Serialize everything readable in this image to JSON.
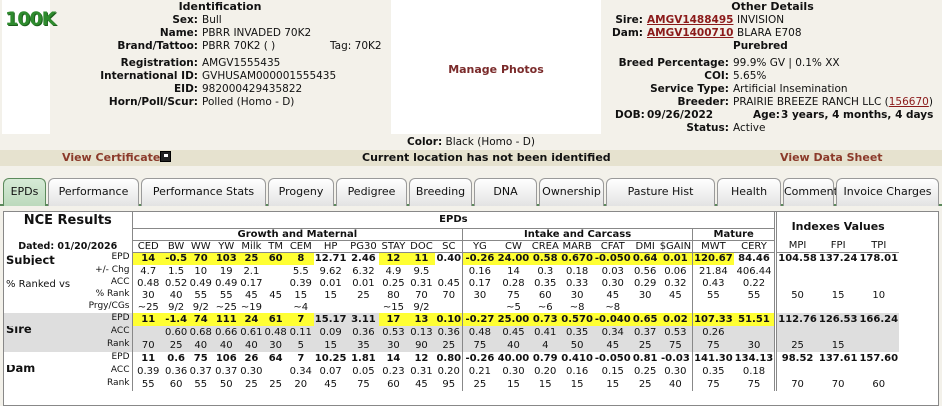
{
  "logo": {
    "text": "100K"
  },
  "identification": {
    "title": "Identification",
    "fields": [
      {
        "label": "Sex:",
        "value": "Bull"
      },
      {
        "label": "Name:",
        "value": "PBRR INVADED 70K2"
      },
      {
        "label": "Brand/Tattoo:",
        "value": "PBRR 70K2 ( )",
        "extra": "Tag: 70K2"
      },
      {
        "label": "Registration:",
        "value": "AMGV1555435"
      },
      {
        "label": "International ID:",
        "value": "GVHUSAM000001555435"
      },
      {
        "label": "EID:",
        "value": "982000429435822"
      },
      {
        "label": "Horn/Poll/Scur:",
        "value": "Polled (Homo - D)"
      }
    ],
    "color_label": "Color:",
    "color_value": "Black (Homo - D)"
  },
  "photos": {
    "manage_label": "Manage Photos"
  },
  "other_details": {
    "title": "Other Details",
    "sire_label": "Sire:",
    "sire_link": "AMGV1488495",
    "sire_name": "INVISION",
    "dam_label": "Dam:",
    "dam_link": "AMGV1400710",
    "dam_name": "BLARA E708",
    "breed_status": "Purebred",
    "fields": [
      {
        "label": "Breed Percentage:",
        "value": "99.9% GV | 0.1% XX"
      },
      {
        "label": "COI:",
        "value": "5.65%"
      },
      {
        "label": "Service Type:",
        "value": "Artificial Insemination"
      }
    ],
    "breeder_label": "Breeder:",
    "breeder_name": "PRAIRIE BREEZE RANCH LLC (",
    "breeder_link": "156670",
    "breeder_close": ")",
    "dob_label": "DOB:",
    "dob_value": "09/26/2022",
    "age_label": "Age:",
    "age_value": "3 years, 4 months, 4 days",
    "status_label": "Status:",
    "status_value": "Active"
  },
  "actions": {
    "view_certificate": "View Certificate",
    "location": "Current location has not been identified",
    "view_data_sheet": "View Data Sheet"
  },
  "tabs": [
    "EPDs",
    "Performance",
    "Performance Stats",
    "Progeny",
    "Pedigree",
    "Breeding",
    "DNA",
    "Ownership",
    "Pasture Hist",
    "Health",
    "Comments",
    "Invoice Charges"
  ],
  "active_tab": "EPDs",
  "epd_table": {
    "title": "NCE Results",
    "dated": "Dated: 01/20/2026",
    "epds_header": "EPDs",
    "indexes_header": "Indexes Values",
    "groups": [
      "Growth and Maternal",
      "Intake and Carcass",
      "Mature"
    ],
    "columns": [
      "CED",
      "BW",
      "WW",
      "YW",
      "Milk",
      "TM",
      "CEM",
      "HP",
      "PG30",
      "STAY",
      "DOC",
      "SC",
      "YG",
      "CW",
      "CREA",
      "MARB",
      "CFAT",
      "DMI",
      "$GAIN",
      "MWT",
      "CERY",
      "MPI",
      "FPI",
      "TPI"
    ],
    "subject": {
      "name": "Subject",
      "ranked_label": "% Ranked vs Active Gelbvieh Sires",
      "row_labels": [
        "EPD",
        "+/- Chg",
        "ACC",
        "% Rank",
        "Prgy/CGs"
      ],
      "epd": [
        "14",
        "-0.5",
        "70",
        "103",
        "25",
        "60",
        "8",
        "12.71",
        "2.46",
        "12",
        "11",
        "0.40",
        "-0.26",
        "24.00",
        "0.58",
        "0.670",
        "-0.050",
        "0.64",
        "0.01",
        "120.67",
        "84.46",
        "104.58",
        "137.24",
        "178.01"
      ],
      "chg": [
        "4.7",
        "1.5",
        "10",
        "19",
        "2.1",
        "",
        "5.5",
        "9.62",
        "6.32",
        "4.9",
        "9.5",
        "",
        "0.16",
        "14",
        "0.3",
        "0.18",
        "0.03",
        "0.56",
        "0.06",
        "21.84",
        "406.44",
        "",
        "",
        ""
      ],
      "acc": [
        "0.48",
        "0.52",
        "0.49",
        "0.49",
        "0.17",
        "",
        "0.39",
        "0.01",
        "0.01",
        "0.25",
        "0.31",
        "0.45",
        "0.17",
        "0.28",
        "0.35",
        "0.33",
        "0.30",
        "0.29",
        "0.32",
        "0.43",
        "0.22",
        "",
        "",
        ""
      ],
      "rank": [
        "30",
        "40",
        "55",
        "55",
        "45",
        "45",
        "15",
        "15",
        "25",
        "80",
        "70",
        "70",
        "30",
        "75",
        "60",
        "30",
        "45",
        "30",
        "45",
        "55",
        "55",
        "50",
        "15",
        "10"
      ],
      "prgy": [
        "~25",
        "9/2",
        "9/2",
        "~25",
        "~19",
        "",
        "~4",
        "",
        "",
        "~15",
        "9/2",
        "",
        "",
        "~5",
        "~6",
        "~8",
        "~8",
        "",
        "",
        "",
        "",
        "",
        "",
        ""
      ],
      "highlight": [
        0,
        1,
        2,
        3,
        4,
        5,
        6,
        9,
        10,
        12,
        13,
        14,
        15,
        16,
        17,
        18,
        19
      ]
    },
    "sire": {
      "name": "Sire",
      "row_labels": [
        "EPD",
        "ACC",
        "Rank"
      ],
      "epd": [
        "11",
        "-1.4",
        "74",
        "111",
        "24",
        "61",
        "7",
        "15.17",
        "3.11",
        "17",
        "13",
        "0.10",
        "-0.27",
        "25.00",
        "0.73",
        "0.570",
        "-0.040",
        "0.65",
        "0.02",
        "107.33",
        "51.51",
        "112.76",
        "126.53",
        "166.24"
      ],
      "acc": [
        "0.60",
        "0.68",
        "0.66",
        "0.61",
        "0.48",
        "0.11",
        "0.09",
        "0.36",
        "0.53",
        "0.13",
        "0.36",
        "0.48",
        "0.45",
        "0.41",
        "0.35",
        "0.34",
        "0.37",
        "0.53",
        "0.26",
        "",
        "",
        ""
      ],
      "acc_start": 1,
      "rank": [
        "70",
        "25",
        "40",
        "40",
        "40",
        "30",
        "5",
        "15",
        "35",
        "30",
        "90",
        "25",
        "75",
        "40",
        "4",
        "50",
        "45",
        "25",
        "75",
        "75",
        "30",
        "25",
        "15"
      ],
      "highlight": [
        0,
        1,
        2,
        3,
        4,
        5,
        6,
        9,
        10,
        11,
        12,
        13,
        14,
        15,
        16,
        17,
        18,
        19,
        20
      ]
    },
    "dam": {
      "name": "Dam",
      "row_labels": [
        "EPD",
        "ACC",
        "Rank"
      ],
      "epd": [
        "11",
        "0.6",
        "75",
        "106",
        "26",
        "64",
        "7",
        "10.25",
        "1.81",
        "14",
        "12",
        "0.80",
        "-0.26",
        "40.00",
        "0.79",
        "0.410",
        "-0.050",
        "0.81",
        "-0.03",
        "141.30",
        "134.13",
        "98.52",
        "137.61",
        "157.60"
      ],
      "acc": [
        "0.39",
        "0.36",
        "0.37",
        "0.37",
        "0.30",
        "",
        "0.34",
        "0.07",
        "0.05",
        "0.23",
        "0.31",
        "0.20",
        "0.21",
        "0.30",
        "0.20",
        "0.16",
        "0.15",
        "0.25",
        "0.30",
        "0.35",
        "0.18",
        "",
        "",
        ""
      ],
      "rank": [
        "55",
        "60",
        "55",
        "50",
        "25",
        "25",
        "20",
        "45",
        "75",
        "60",
        "45",
        "95",
        "25",
        "15",
        "15",
        "15",
        "15",
        "25",
        "40",
        "75",
        "75",
        "70",
        "70",
        "60"
      ],
      "highlight": []
    }
  }
}
